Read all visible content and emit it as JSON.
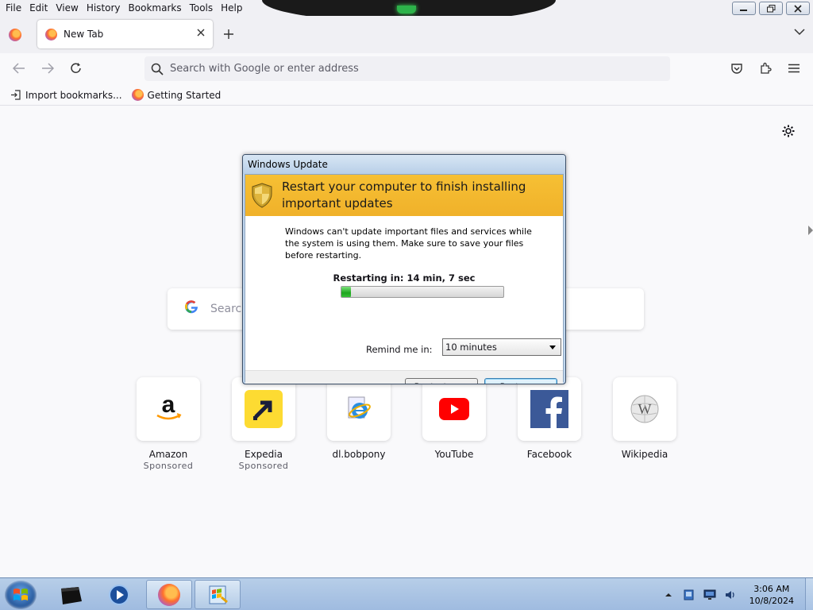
{
  "menubar": {
    "items": [
      "File",
      "Edit",
      "View",
      "History",
      "Bookmarks",
      "Tools",
      "Help"
    ]
  },
  "tabs": [
    {
      "title": "New Tab"
    }
  ],
  "urlbar": {
    "placeholder": "Search with Google or enter address"
  },
  "bookmarks": {
    "items": [
      {
        "label": "Import bookmarks...",
        "icon": "import-icon"
      },
      {
        "label": "Getting Started",
        "icon": "firefox-icon"
      }
    ]
  },
  "newtab": {
    "search_placeholder": "Search",
    "tiles": [
      {
        "title": "Amazon",
        "sub": "Sponsored",
        "icon": "amazon-icon"
      },
      {
        "title": "Expedia",
        "sub": "Sponsored",
        "icon": "expedia-icon"
      },
      {
        "title": "dl.bobpony",
        "sub": "",
        "icon": "ie-icon"
      },
      {
        "title": "YouTube",
        "sub": "",
        "icon": "youtube-icon"
      },
      {
        "title": "Facebook",
        "sub": "",
        "icon": "facebook-icon"
      },
      {
        "title": "Wikipedia",
        "sub": "",
        "icon": "wikipedia-icon"
      }
    ]
  },
  "dialog": {
    "title": "Windows Update",
    "heading": "Restart your computer to finish installing important updates",
    "message": "Windows can't update important files and services while the system is using them. Make sure to save your files before restarting.",
    "countdown": "Restarting in: 14 min, 7 sec",
    "progress": 0.06,
    "remind_label": "Remind me in:",
    "remind_value": "10 minutes",
    "restart_label": "Restart now",
    "postpone_label": "Postpone"
  },
  "taskbar": {
    "time": "3:06 AM",
    "date": "10/8/2024"
  },
  "colors": {
    "accent_yellow": "#f0b12a",
    "progress_green": "#1ea51e",
    "taskbar_blue": "#9fbbe0"
  }
}
